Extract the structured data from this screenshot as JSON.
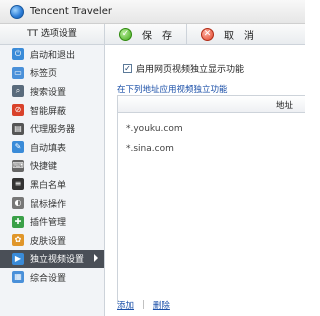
{
  "app": {
    "title": "Tencent Traveler"
  },
  "sidebar": {
    "header": "TT 选项设置",
    "items": [
      {
        "label": "启动和退出",
        "icon": "power-icon",
        "color": "#3a8bd8"
      },
      {
        "label": "标签页",
        "icon": "tabs-icon",
        "color": "#4a90d9"
      },
      {
        "label": "搜索设置",
        "icon": "search-icon",
        "color": "#5a6b7c"
      },
      {
        "label": "智能屏蔽",
        "icon": "block-icon",
        "color": "#d9422b"
      },
      {
        "label": "代理服务器",
        "icon": "server-icon",
        "color": "#555555"
      },
      {
        "label": "自动填表",
        "icon": "form-icon",
        "color": "#3a8bd8"
      },
      {
        "label": "快捷键",
        "icon": "keyboard-icon",
        "color": "#666666"
      },
      {
        "label": "黑白名单",
        "icon": "list-icon",
        "color": "#333333"
      },
      {
        "label": "鼠标操作",
        "icon": "mouse-icon",
        "color": "#777777"
      },
      {
        "label": "插件管理",
        "icon": "plugin-icon",
        "color": "#3aa048"
      },
      {
        "label": "皮肤设置",
        "icon": "skin-icon",
        "color": "#e0962a"
      },
      {
        "label": "独立视频设置",
        "icon": "video-icon",
        "color": "#3a8bd8"
      },
      {
        "label": "综合设置",
        "icon": "grid-icon",
        "color": "#4a90d9"
      }
    ],
    "active_index": 11
  },
  "toolbar": {
    "save_label": "保　存",
    "cancel_label": "取　消"
  },
  "main": {
    "checkbox_label": "启用网页视频独立显示功能",
    "checkbox_checked": true,
    "section_title": "在下列地址应用视频独立功能",
    "table": {
      "column_header": "地址",
      "rows": [
        "*.youku.com",
        "*.sina.com"
      ]
    },
    "footer": {
      "add_label": "添加",
      "separator": "|",
      "delete_label": "删除"
    }
  }
}
